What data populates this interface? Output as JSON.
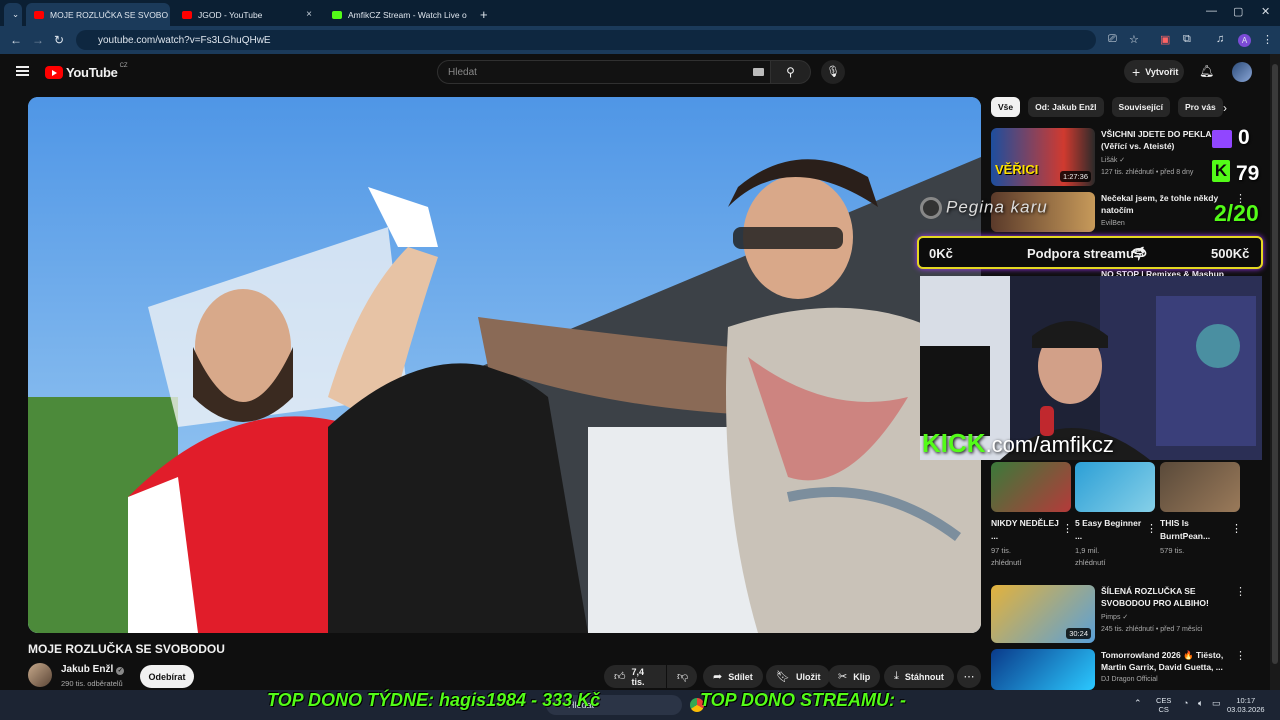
{
  "browser": {
    "tabs": [
      {
        "label": "MOJE ROZLUČKA SE SVOBO",
        "active": true,
        "color": "#ff0000"
      },
      {
        "label": "JGOD - YouTube",
        "active": false,
        "color": "#ff0000"
      },
      {
        "label": "AmfikCZ Stream - Watch Live o",
        "active": false,
        "color": "#53fc18"
      }
    ],
    "url": "youtube.com/watch?v=Fs3LGhuQHwE",
    "profile_letter": "A"
  },
  "yt": {
    "logo_text": "YouTube",
    "country": "CZ",
    "search_placeholder": "Hledat",
    "create_label": "Vytvořit"
  },
  "video": {
    "title": "MOJE ROZLUČKA SE SVOBODOU",
    "channel": "Jakub Enžl",
    "subscribers": "290 tis. odběratelů",
    "subscribe_label": "Odebírat",
    "likes": "7,4 tis.",
    "share": "Sdílet",
    "save": "Uložit",
    "clip": "Klip",
    "download": "Stáhnout"
  },
  "chips": [
    "Vše",
    "Od: Jakub Enžl",
    "Související",
    "Pro vás"
  ],
  "recommendations": [
    {
      "title": "VŠICHNI JDETE DO PEKLA! (Věřící vs. Ateisté)",
      "channel": "Lišák",
      "meta": "127 tis. zhlédnutí • před 8 dny",
      "duration": "1:27:36",
      "thumb_text": "VĚŘICI"
    },
    {
      "title": "Nečekal jsem, že tohle někdy natočím",
      "channel": "EvilBen",
      "meta": "",
      "duration": "",
      "thumb_text": ""
    },
    {
      "title": "NO STOP | Remixes & Mashup",
      "channel": "",
      "meta": "",
      "duration": "",
      "thumb_text": ""
    }
  ],
  "shorts": [
    {
      "title": "NIKDY NEDĚLEJ ...",
      "views": "97 tis.",
      "views_label": "zhlédnutí"
    },
    {
      "title": "5 Easy Beginner ...",
      "views": "1,9 mil.",
      "views_label": "zhlédnutí"
    },
    {
      "title": "THIS Is BurntPean...",
      "views": "579 tis.",
      "views_label": "zhlédnutí"
    }
  ],
  "recommendations2": [
    {
      "title": "ŠÍLENÁ ROZLUČKA SE SVOBODOU PRO ALBIHO!",
      "channel": "Pimps",
      "meta": "245 tis. zhlédnutí • před 7 měsíci",
      "duration": "30:24"
    },
    {
      "title": "Tomorrowland 2026 🔥 Tiësto, Martin Garrix, David Guetta, ...",
      "channel": "DJ Dragon Official",
      "meta": "",
      "duration": ""
    }
  ],
  "overlay": {
    "twitch_count": "0",
    "kick_count": "79",
    "goal": "2/20",
    "pegina": "Pegina karu",
    "support_left": "0Kč",
    "support_mid": "Podpora streamu",
    "support_right": "500Kč",
    "kick_word": "KICK",
    "kick_url": ".com/amfikcz",
    "ticker_week": "TOP DONO TÝDNE:  hagis1984 - 333 Kč",
    "ticker_stream": "TOP DONO STREAMU: -"
  },
  "taskbar": {
    "search": "Hledat",
    "lang_top": "CES",
    "lang_bottom": "CS",
    "time": "10:17",
    "date": "03.03.2026"
  }
}
